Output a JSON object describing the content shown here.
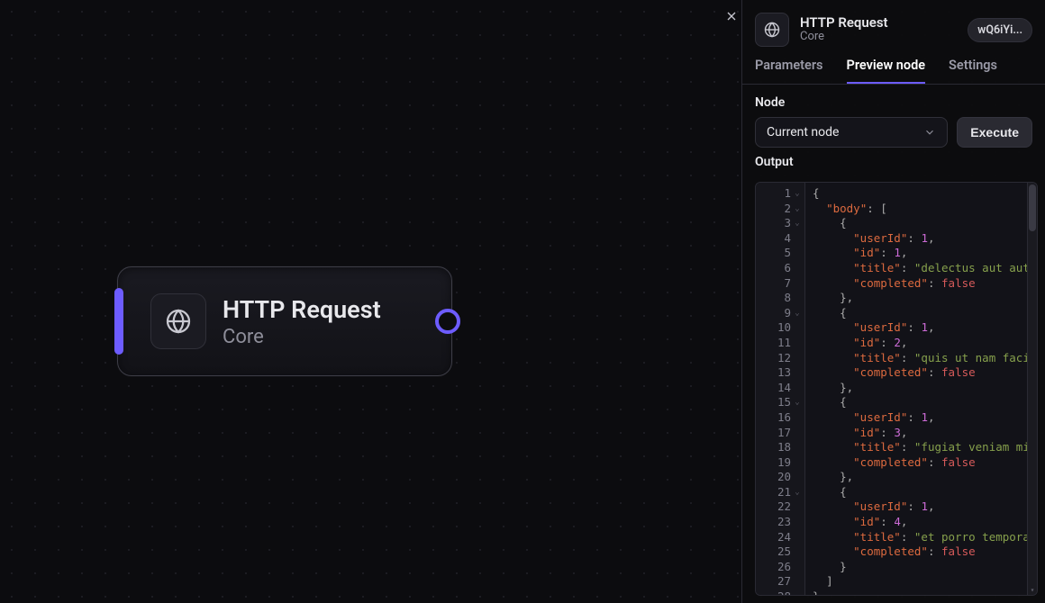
{
  "canvas": {
    "node": {
      "title": "HTTP Request",
      "sub": "Core",
      "icon": "globe-icon"
    }
  },
  "panel": {
    "header": {
      "title": "HTTP Request",
      "sub": "Core",
      "id_pill": "wQ6iYi..."
    },
    "tabs": [
      {
        "id": "parameters",
        "label": "Parameters",
        "active": false
      },
      {
        "id": "preview",
        "label": "Preview node",
        "active": true
      },
      {
        "id": "settings",
        "label": "Settings",
        "active": false
      }
    ],
    "node_section_label": "Node",
    "node_select_value": "Current node",
    "execute_label": "Execute",
    "output_label": "Output",
    "code": {
      "body": [
        {
          "userId": 1,
          "id": 1,
          "title": "delectus aut autem",
          "completed": false
        },
        {
          "userId": 1,
          "id": 2,
          "title": "quis ut nam facilis et officia qui",
          "completed": false
        },
        {
          "userId": 1,
          "id": 3,
          "title": "fugiat veniam minus",
          "completed": false
        },
        {
          "userId": 1,
          "id": 4,
          "title": "et porro tempora",
          "completed": false
        }
      ]
    }
  },
  "colors": {
    "accent": "#6d5cff"
  }
}
